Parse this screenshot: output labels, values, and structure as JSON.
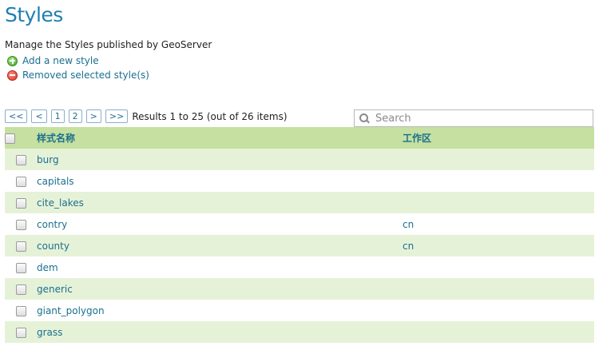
{
  "page": {
    "title": "Styles",
    "description": "Manage the Styles published by GeoServer"
  },
  "actions": {
    "add_label": "Add a new style",
    "remove_label": "Removed selected style(s)"
  },
  "pager": {
    "first": "<<",
    "prev": "<",
    "pages": [
      "1",
      "2"
    ],
    "next": ">",
    "last": ">>",
    "results": "Results 1 to 25 (out of 26 items)"
  },
  "search": {
    "placeholder": "Search"
  },
  "table": {
    "columns": {
      "name": "样式名称",
      "workspace": "工作区"
    },
    "rows": [
      {
        "name": "burg",
        "workspace": ""
      },
      {
        "name": "capitals",
        "workspace": ""
      },
      {
        "name": "cite_lakes",
        "workspace": ""
      },
      {
        "name": "contry",
        "workspace": "cn"
      },
      {
        "name": "county",
        "workspace": "cn"
      },
      {
        "name": "dem",
        "workspace": ""
      },
      {
        "name": "generic",
        "workspace": ""
      },
      {
        "name": "giant_polygon",
        "workspace": ""
      },
      {
        "name": "grass",
        "workspace": ""
      }
    ]
  },
  "colors": {
    "title": "#1f80b0",
    "link": "#1a6f8f",
    "header_bg": "#c5e0a0",
    "row_alt_bg": "#e6f2d8"
  },
  "icons": {
    "add": "add-circle-icon",
    "remove": "remove-circle-icon",
    "search": "search-icon"
  }
}
